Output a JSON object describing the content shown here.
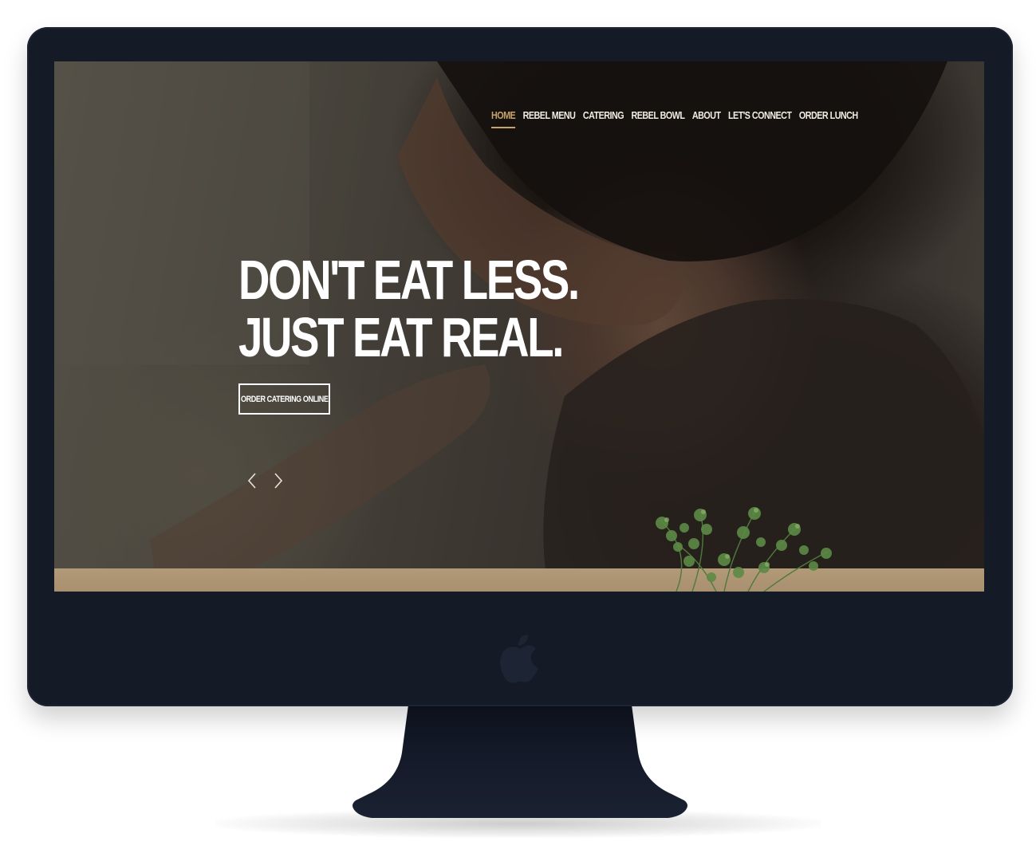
{
  "site": {
    "nav": [
      {
        "label": "HOME",
        "active": true
      },
      {
        "label": "REBEL MENU",
        "active": false
      },
      {
        "label": "CATERING",
        "active": false
      },
      {
        "label": "REBEL BOWL",
        "active": false
      },
      {
        "label": "ABOUT",
        "active": false
      },
      {
        "label": "LET'S CONNECT",
        "active": false
      },
      {
        "label": "ORDER LUNCH",
        "active": false
      }
    ],
    "hero": {
      "headline_line1": "DON'T EAT LESS.",
      "headline_line2": "JUST EAT REAL.",
      "cta_label": "ORDER CATERING ONLINE"
    },
    "slider": {
      "prev_icon": "chevron-left-icon",
      "next_icon": "chevron-right-icon"
    }
  },
  "device": {
    "type": "desktop-monitor",
    "logo_icon": "apple-logo-icon"
  },
  "colors": {
    "bezel": "#141a26",
    "nav_active": "#c9a46a",
    "nav_text": "#f1ece4",
    "headline": "#ffffff",
    "kraft": "#b29a78"
  }
}
